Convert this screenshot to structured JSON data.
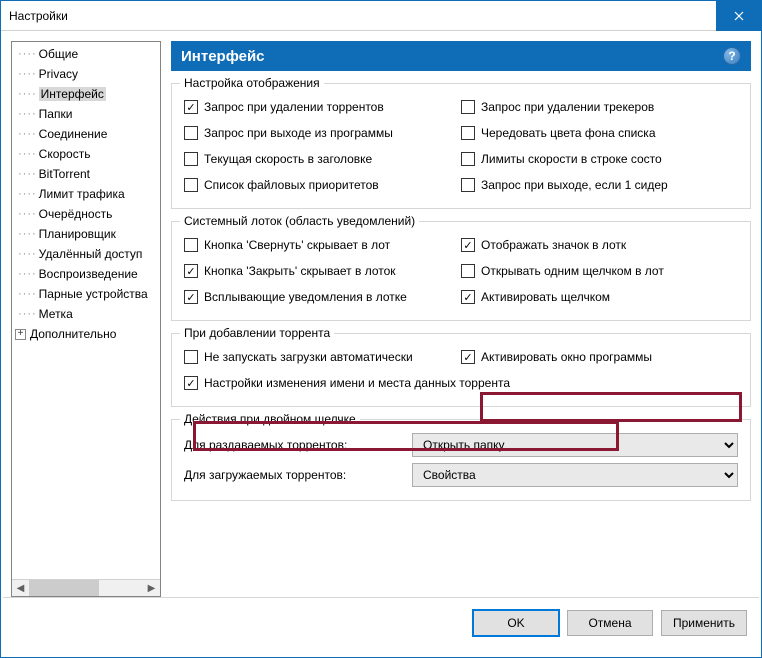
{
  "window": {
    "title": "Настройки"
  },
  "tree": {
    "items": [
      {
        "label": "Общие",
        "selected": false,
        "expandable": false
      },
      {
        "label": "Privacy",
        "selected": false,
        "expandable": false
      },
      {
        "label": "Интерфейс",
        "selected": true,
        "expandable": false
      },
      {
        "label": "Папки",
        "selected": false,
        "expandable": false
      },
      {
        "label": "Соединение",
        "selected": false,
        "expandable": false
      },
      {
        "label": "Скорость",
        "selected": false,
        "expandable": false
      },
      {
        "label": "BitTorrent",
        "selected": false,
        "expandable": false
      },
      {
        "label": "Лимит трафика",
        "selected": false,
        "expandable": false
      },
      {
        "label": "Очерёдность",
        "selected": false,
        "expandable": false
      },
      {
        "label": "Планировщик",
        "selected": false,
        "expandable": false
      },
      {
        "label": "Удалённый доступ",
        "selected": false,
        "expandable": false
      },
      {
        "label": "Воспроизведение",
        "selected": false,
        "expandable": false
      },
      {
        "label": "Парные устройства",
        "selected": false,
        "expandable": false
      },
      {
        "label": "Метка",
        "selected": false,
        "expandable": false
      },
      {
        "label": "Дополнительно",
        "selected": false,
        "expandable": true
      }
    ]
  },
  "header": {
    "title": "Интерфейс"
  },
  "group1": {
    "title": "Настройка отображения",
    "left": [
      {
        "label": "Запрос при удалении торрентов",
        "checked": true
      },
      {
        "label": "Запрос при выходе из программы",
        "checked": false
      },
      {
        "label": "Текущая скорость в заголовке",
        "checked": false
      },
      {
        "label": "Список файловых приоритетов",
        "checked": false
      }
    ],
    "right": [
      {
        "label": "Запрос при удалении трекеров",
        "checked": false
      },
      {
        "label": "Чередовать цвета фона списка",
        "checked": false
      },
      {
        "label": "Лимиты скорости в строке состо",
        "checked": false
      },
      {
        "label": "Запрос при выходе, если 1 сидер",
        "checked": false
      }
    ]
  },
  "group2": {
    "title": "Системный лоток (область уведомлений)",
    "left": [
      {
        "label": "Кнопка 'Свернуть' скрывает в лот",
        "checked": false
      },
      {
        "label": "Кнопка 'Закрыть' скрывает в лоток",
        "checked": true
      },
      {
        "label": "Всплывающие уведомления в лотке",
        "checked": true
      }
    ],
    "right": [
      {
        "label": "Отображать значок в лотк",
        "checked": true
      },
      {
        "label": "Открывать одним щелчком в лот",
        "checked": false
      },
      {
        "label": "Активировать щелчком",
        "checked": true
      }
    ]
  },
  "group3": {
    "title": "При добавлении торрента",
    "left": [
      {
        "label": "Не запускать загрузки автоматически",
        "checked": false
      }
    ],
    "right": [
      {
        "label": "Активировать окно программы",
        "checked": true
      }
    ],
    "full": [
      {
        "label": "Настройки изменения имени и места данных торрента",
        "checked": true
      }
    ]
  },
  "group4": {
    "title": "Действия при двойном щелчке",
    "rows": [
      {
        "label": "Для раздаваемых торрентов:",
        "value": "Открыть папку"
      },
      {
        "label": "Для загружаемых торрентов:",
        "value": "Свойства"
      }
    ]
  },
  "buttons": {
    "ok": "OK",
    "cancel": "Отмена",
    "apply": "Применить"
  }
}
